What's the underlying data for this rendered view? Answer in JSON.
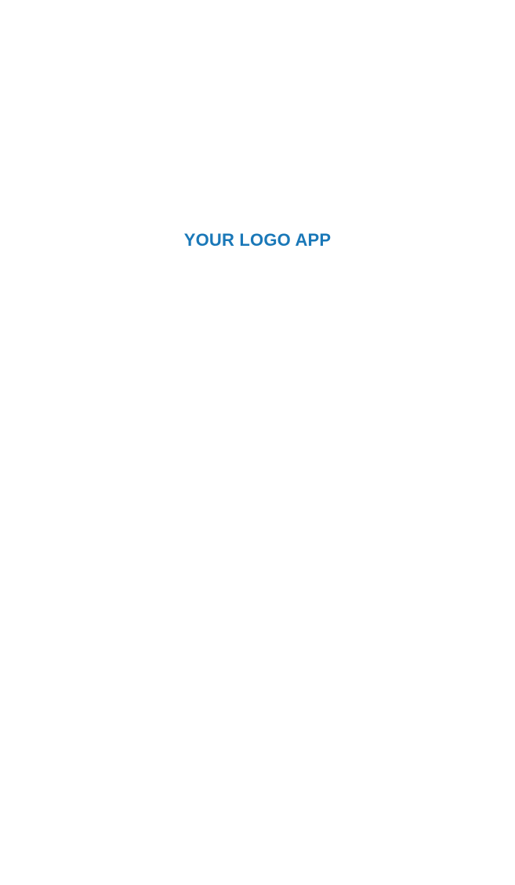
{
  "splash": {
    "logo_text": "YOUR LOGO APP"
  },
  "colors": {
    "brand": "#1a78b8",
    "background": "#ffffff"
  }
}
